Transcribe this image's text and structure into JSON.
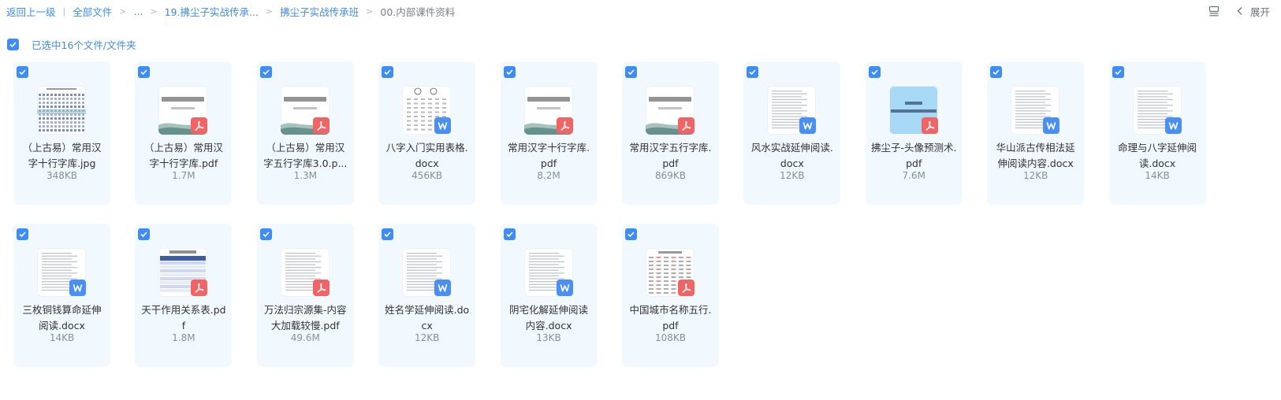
{
  "breadcrumb": {
    "back": "返回上一级",
    "all_files": "全部文件",
    "ellipsis": "...",
    "level1": "19.拂尘子实战传承...",
    "level2": "拂尘子实战传承班",
    "current": "00.内部课件资料"
  },
  "toolbar": {
    "expand_label": "展开"
  },
  "selection": {
    "label": "已选中16个文件/文件夹"
  },
  "colors": {
    "accent": "#3e8cf5",
    "card_bg": "#f1f8fe",
    "pdf_badge": "#f06465",
    "word_badge": "#4a8ff3"
  },
  "files": [
    {
      "name": "（上古易）常用汉字十行字库.jpg",
      "size": "348KB",
      "type": "jpg",
      "thumb": "grid"
    },
    {
      "name": "（上古易）常用汉字十行字库.pdf",
      "size": "1.7M",
      "type": "pdf",
      "thumb": "cover"
    },
    {
      "name": "（上古易）常用汉字五行字库3.0.p...",
      "size": "1.3M",
      "type": "pdf",
      "thumb": "cover"
    },
    {
      "name": "八字入门实用表格.docx",
      "size": "456KB",
      "type": "docx",
      "thumb": "table"
    },
    {
      "name": "常用汉字十行字库.pdf",
      "size": "8.2M",
      "type": "pdf",
      "thumb": "cover"
    },
    {
      "name": "常用汉字五行字库.pdf",
      "size": "869KB",
      "type": "pdf",
      "thumb": "cover"
    },
    {
      "name": "风水实战延伸阅读.docx",
      "size": "12KB",
      "type": "docx",
      "thumb": "doc"
    },
    {
      "name": "拂尘子-头像预测术.pdf",
      "size": "7.6M",
      "type": "pdf",
      "thumb": "blue"
    },
    {
      "name": "华山派古传相法延伸阅读内容.docx",
      "size": "12KB",
      "type": "docx",
      "thumb": "doc"
    },
    {
      "name": "命理与八字延伸阅读.docx",
      "size": "14KB",
      "type": "docx",
      "thumb": "doc"
    },
    {
      "name": "三枚铜钱算命延伸阅读.docx",
      "size": "14KB",
      "type": "docx",
      "thumb": "doc"
    },
    {
      "name": "天干作用关系表.pdf",
      "size": "1.8M",
      "type": "pdf",
      "thumb": "bluetable"
    },
    {
      "name": "万法归宗源集-内容大加载较慢.pdf",
      "size": "49.6M",
      "type": "pdf",
      "thumb": "doc"
    },
    {
      "name": "姓名学延伸阅读.docx",
      "size": "12KB",
      "type": "docx",
      "thumb": "doc"
    },
    {
      "name": "阴宅化解延伸阅读内容.docx",
      "size": "13KB",
      "type": "docx",
      "thumb": "doc"
    },
    {
      "name": "中国城市名称五行.pdf",
      "size": "108KB",
      "type": "pdf",
      "thumb": "redtable"
    }
  ]
}
